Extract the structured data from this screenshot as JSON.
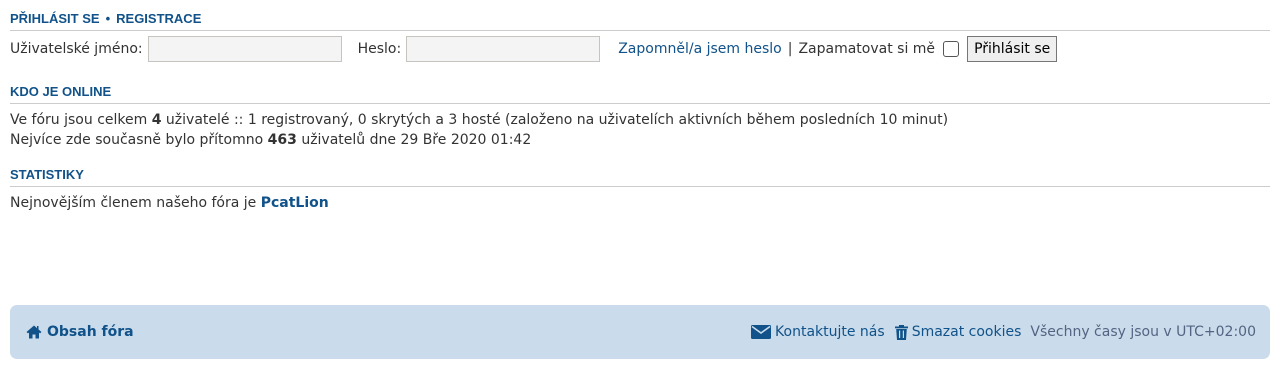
{
  "login": {
    "heading_login": "PŘIHLÁSIT SE",
    "heading_sep": "•",
    "heading_register": "REGISTRACE",
    "username_label": "Uživatelské jméno:",
    "username_value": "",
    "password_label": "Heslo:",
    "password_value": "",
    "forgot_link": "Zapomněl/a jsem heslo",
    "separator": "|",
    "remember_label": "Zapamatovat si mě",
    "remember_checked": false,
    "submit_label": "Přihlásit se"
  },
  "online": {
    "heading": "KDO JE ONLINE",
    "line1_prefix": "Ve fóru jsou celkem ",
    "line1_count": "4",
    "line1_suffix": " uživatelé :: 1 registrovaný, 0 skrytých a 3 hosté (založeno na uživatelích aktivních během posledních 10 minut)",
    "line2_prefix": "Nejvíce zde současně bylo přítomno ",
    "line2_count": "463",
    "line2_suffix": " uživatelů dne 29 Bře 2020 01:42"
  },
  "stats": {
    "heading": "STATISTIKY",
    "text_prefix": "Nejnovějším členem našeho fóra je ",
    "newest_member": "PcatLion"
  },
  "footer": {
    "home_label": "Obsah fóra",
    "home_icon": "home-icon",
    "contact_label": "Kontaktujte nás",
    "contact_icon": "envelope-icon",
    "cookies_label": "Smazat cookies",
    "cookies_icon": "trash-icon",
    "timezone_text": "Všechny časy jsou v UTC+02:00"
  },
  "colors": {
    "link": "#105289",
    "footer_bg": "#cadceb",
    "text": "#333333"
  }
}
